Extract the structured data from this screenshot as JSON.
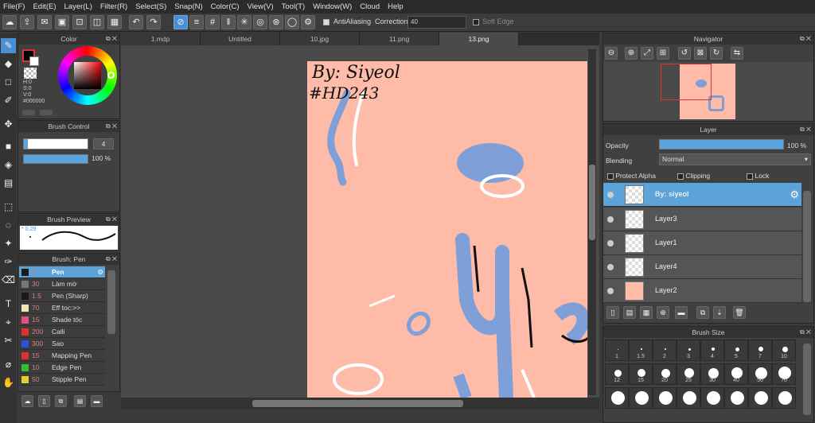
{
  "menu": [
    "File(F)",
    "Edit(E)",
    "Layer(L)",
    "Filter(R)",
    "Select(S)",
    "Snap(N)",
    "Color(C)",
    "View(V)",
    "Tool(T)",
    "Window(W)",
    "Cloud",
    "Help"
  ],
  "toolbar": {
    "antialiasing_label": "AntiAliasing",
    "correction_label": "Correction",
    "correction_value": "40",
    "soft_edge_label": "Soft Edge"
  },
  "color_panel": {
    "title": "Color",
    "h": "H:0",
    "s": "S:0",
    "v": "V:0",
    "hex": "#000000",
    "fg_color": "#000000",
    "accent": "#4a8fd4"
  },
  "brush_control": {
    "title": "Brush Control",
    "size": "4",
    "opacity": "100 %"
  },
  "brush_preview": {
    "title": "Brush Preview",
    "size_label": "* 0.29"
  },
  "brush_panel": {
    "title": "Brush: Pen",
    "items": [
      {
        "size": "4",
        "name": "Pen",
        "color": "#1a1a1a"
      },
      {
        "size": "30",
        "name": "Làm mờ",
        "color": "#777777"
      },
      {
        "size": "1.5",
        "name": "Pen (Sharp)",
        "color": "#1a1a1a"
      },
      {
        "size": "70",
        "name": "Eff toc:>>",
        "color": "#f2e6b0"
      },
      {
        "size": "15",
        "name": "Shade tóc",
        "color": "#e05080"
      },
      {
        "size": "200",
        "name": "Calli",
        "color": "#e03030"
      },
      {
        "size": "300",
        "name": "Sao",
        "color": "#3050e0"
      },
      {
        "size": "15",
        "name": "Mapping Pen",
        "color": "#e03030"
      },
      {
        "size": "10",
        "name": "Edge Pen",
        "color": "#30c030"
      },
      {
        "size": "50",
        "name": "Stipple Pen",
        "color": "#e0d030"
      }
    ]
  },
  "tabs": [
    "1.mdp",
    "Untitled",
    "10.jpg",
    "11.png",
    "13.png"
  ],
  "canvas": {
    "signature_line1": "By: Siyeol",
    "signature_line2": "#HD243",
    "bg_color": "#fdbba8",
    "stroke_color": "#7f9fd8"
  },
  "navigator": {
    "title": "Navigator"
  },
  "layer_panel": {
    "title": "Layer",
    "opacity_label": "Opacity",
    "opacity_value": "100 %",
    "blending_label": "Blending",
    "blending_value": "Normal",
    "protect_alpha": "Protect Alpha",
    "clipping": "Clipping",
    "lock": "Lock",
    "layers": [
      "By: siyeol",
      "Layer3",
      "Layer1",
      "Layer4",
      "Layer2"
    ]
  },
  "brush_size": {
    "title": "Brush Size",
    "row1": [
      "1",
      "1.5",
      "2",
      "3",
      "4",
      "5",
      "7",
      "10"
    ],
    "row2": [
      "12",
      "15",
      "20",
      "25",
      "30",
      "40",
      "50",
      "70"
    ]
  }
}
